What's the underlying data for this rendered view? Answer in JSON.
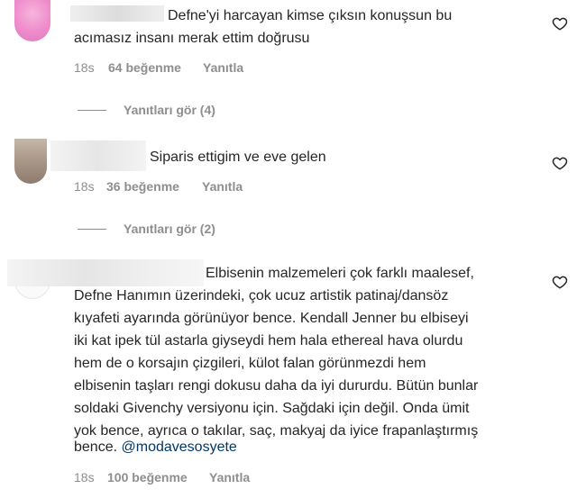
{
  "comments": [
    {
      "text_lines": [
        "Defne'yi harcayan kimse çıksın konuşsun bu",
        "acımasız insanı merak ettim doğrusu"
      ],
      "time": "18s",
      "likes": "64 beğenme",
      "reply": "Yanıtla",
      "view_replies": "Yanıtları gör (4)"
    },
    {
      "text_lines": [
        "Siparis ettigim ve eve gelen"
      ],
      "time": "18s",
      "likes": "36 beğenme",
      "reply": "Yanıtla",
      "view_replies": "Yanıtları gör (2)"
    },
    {
      "text_lines": [
        "Elbisenin malzemeleri çok farklı maalesef,",
        "Defne Hanımın üzerindeki, çok ucuz artistik patinaj/dansöz",
        "kıyafeti ayarında görünüyor bence. Kendall Jenner bu elbiseyi",
        "iki kat ipek tül astarla giyseydi hem hala ethereal hava olurdu",
        "hem de o korsajın çizgileri, külot falan görünmezdi hem",
        "elbisenin taşları rengi dokusu daha da iyi dururdu. Bütün bunlar",
        "soldaki Givenchy versiyonu için. Sağdaki için değil. Onda ümit",
        "yok bence, ayrıca o takılar, saç, makyaj da iyice frapanlaştırmış",
        "bence."
      ],
      "mention": "@modavesosyete",
      "time": "18s",
      "likes": "100 beğenme",
      "reply": "Yanıtla"
    }
  ],
  "icons": {
    "like": "heart-outline-icon"
  },
  "colors": {
    "text": "#262626",
    "muted": "#8e8e8e",
    "mention": "#00376b"
  }
}
